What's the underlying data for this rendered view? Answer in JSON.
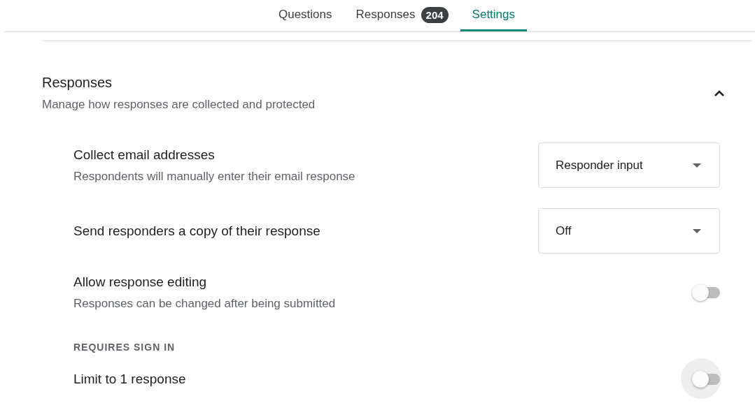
{
  "tabs": [
    {
      "label": "Questions",
      "selected": false
    },
    {
      "label": "Responses",
      "badge": "204",
      "selected": false
    },
    {
      "label": "Settings",
      "selected": true
    }
  ],
  "section": {
    "title": "Responses",
    "subtitle": "Manage how responses are collected and protected",
    "expanded": true
  },
  "settings": [
    {
      "kind": "dropdown",
      "title": "Collect email addresses",
      "description": "Respondents will manually enter their email response",
      "value": "Responder input"
    },
    {
      "kind": "dropdown",
      "title": "Send responders a copy of their response",
      "value": "Off"
    },
    {
      "kind": "toggle",
      "title": "Allow response editing",
      "description": "Responses can be changed after being submitted",
      "on": false
    },
    {
      "kind": "heading",
      "title": "REQUIRES SIGN IN"
    },
    {
      "kind": "toggle",
      "title": "Limit to 1 response",
      "on": false,
      "focused": true
    }
  ]
}
